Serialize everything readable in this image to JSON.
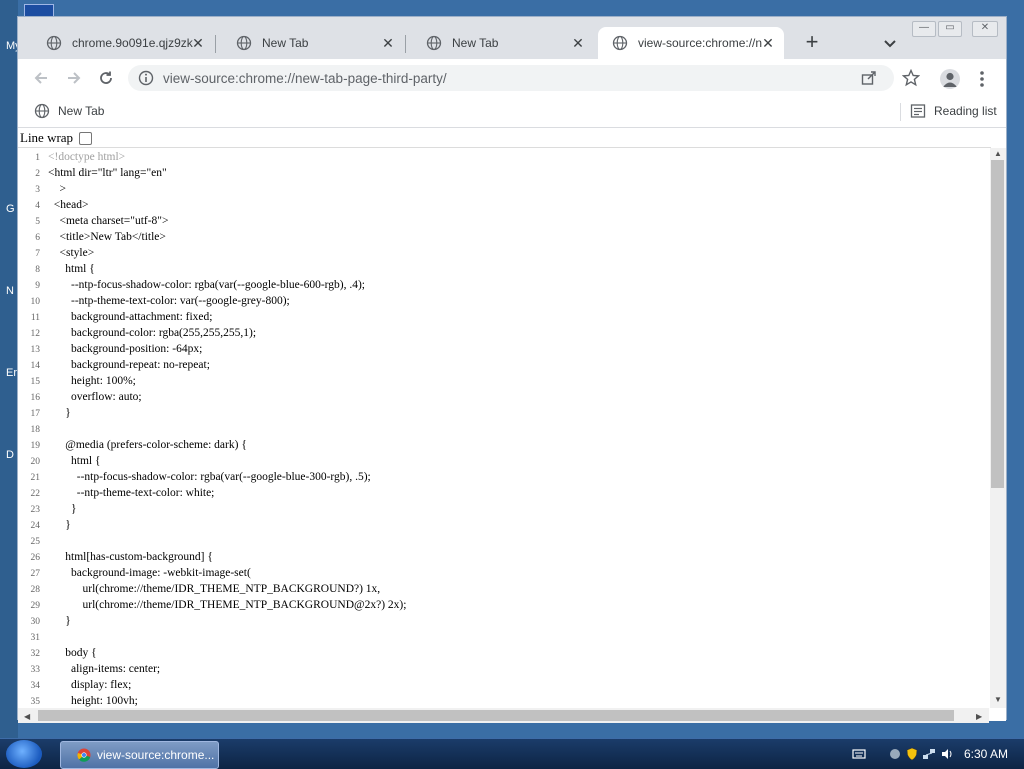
{
  "desktop": {
    "side_letters": [
      "My",
      "G",
      "N",
      "Er",
      "D"
    ]
  },
  "window_controls": {
    "minimize": "—",
    "maximize": "▭",
    "close": "✕"
  },
  "tabs": [
    {
      "label": "chrome.9o091e.qjz9zk",
      "active": false
    },
    {
      "label": "New Tab",
      "active": false
    },
    {
      "label": "New Tab",
      "active": false
    },
    {
      "label": "view-source:chrome://new",
      "active": true
    }
  ],
  "omnibox": {
    "url": "view-source:chrome://new-tab-page-third-party/"
  },
  "bookmarks": {
    "items": [
      {
        "label": "New Tab"
      }
    ],
    "reading_list": "Reading list"
  },
  "viewer": {
    "line_wrap_label": "Line wrap",
    "line_wrap_checked": false
  },
  "source_lines": [
    {
      "n": "1",
      "text": "<!doctype html>",
      "comment": true
    },
    {
      "n": "2",
      "text": "<html dir=\"ltr\" lang=\"en\""
    },
    {
      "n": "3",
      "text": "    >"
    },
    {
      "n": "4",
      "text": "  <head>"
    },
    {
      "n": "5",
      "text": "    <meta charset=\"utf-8\">"
    },
    {
      "n": "6",
      "text": "    <title>New Tab</title>"
    },
    {
      "n": "7",
      "text": "    <style>"
    },
    {
      "n": "8",
      "text": "      html {"
    },
    {
      "n": "9",
      "text": "        --ntp-focus-shadow-color: rgba(var(--google-blue-600-rgb), .4);"
    },
    {
      "n": "10",
      "text": "        --ntp-theme-text-color: var(--google-grey-800);"
    },
    {
      "n": "11",
      "text": "        background-attachment: fixed;"
    },
    {
      "n": "12",
      "text": "        background-color: rgba(255,255,255,1);"
    },
    {
      "n": "13",
      "text": "        background-position: -64px;"
    },
    {
      "n": "14",
      "text": "        background-repeat: no-repeat;"
    },
    {
      "n": "15",
      "text": "        height: 100%;"
    },
    {
      "n": "16",
      "text": "        overflow: auto;"
    },
    {
      "n": "17",
      "text": "      }"
    },
    {
      "n": "18",
      "text": ""
    },
    {
      "n": "19",
      "text": "      @media (prefers-color-scheme: dark) {"
    },
    {
      "n": "20",
      "text": "        html {"
    },
    {
      "n": "21",
      "text": "          --ntp-focus-shadow-color: rgba(var(--google-blue-300-rgb), .5);"
    },
    {
      "n": "22",
      "text": "          --ntp-theme-text-color: white;"
    },
    {
      "n": "23",
      "text": "        }"
    },
    {
      "n": "24",
      "text": "      }"
    },
    {
      "n": "25",
      "text": ""
    },
    {
      "n": "26",
      "text": "      html[has-custom-background] {"
    },
    {
      "n": "27",
      "text": "        background-image: -webkit-image-set("
    },
    {
      "n": "28",
      "text": "            url(chrome://theme/IDR_THEME_NTP_BACKGROUND?) 1x,"
    },
    {
      "n": "29",
      "text": "            url(chrome://theme/IDR_THEME_NTP_BACKGROUND@2x?) 2x);"
    },
    {
      "n": "30",
      "text": "      }"
    },
    {
      "n": "31",
      "text": ""
    },
    {
      "n": "32",
      "text": "      body {"
    },
    {
      "n": "33",
      "text": "        align-items: center;"
    },
    {
      "n": "34",
      "text": "        display: flex;"
    },
    {
      "n": "35",
      "text": "        height: 100vh;"
    }
  ],
  "taskbar": {
    "task_label": "view-source:chrome...",
    "clock": "6:30 AM"
  },
  "colors": {
    "accent": "#1a73e8",
    "tab_strip": "#dee1e6",
    "taskbar": "#1b3c6a"
  }
}
